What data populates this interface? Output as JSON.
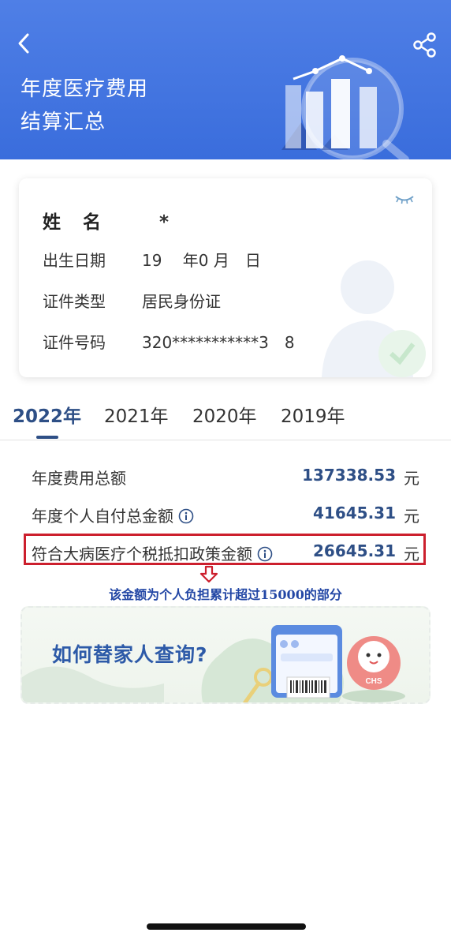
{
  "header": {
    "title_line1": "年度医疗费用",
    "title_line2": "结算汇总",
    "back_icon": "chevron-left-icon",
    "share_icon": "share-icon",
    "background_color": "#3f72e0"
  },
  "id_card": {
    "name_label": "姓 名",
    "name_value": "*",
    "birth_label": "出生日期",
    "birth_value": "19　 年0  月　日",
    "id_type_label": "证件类型",
    "id_type_value": "居民身份证",
    "id_no_label": "证件号码",
    "id_no_value": "320***********3　8",
    "eye_icon": "eye-closed-icon"
  },
  "tabs": [
    {
      "label": "2022年",
      "active": true
    },
    {
      "label": "2021年",
      "active": false
    },
    {
      "label": "2020年",
      "active": false
    },
    {
      "label": "2019年",
      "active": false
    }
  ],
  "summary": {
    "total_label": "年度费用总额",
    "total_value": "137338.53",
    "total_unit": "元",
    "self_pay_label": "年度个人自付总金额",
    "self_pay_value": "41645.31",
    "self_pay_unit": "元",
    "policy_label": "符合大病医疗个税抵扣政策金额",
    "policy_value": "26645.31",
    "policy_unit": "元",
    "accent_color": "#2e4f86",
    "highlight_color": "#cc1f2d"
  },
  "annotation": {
    "note": "该金额为个人负担累计超过15000的部分"
  },
  "banner": {
    "text": "如何替家人查询?",
    "mascot_label": "CHS"
  }
}
